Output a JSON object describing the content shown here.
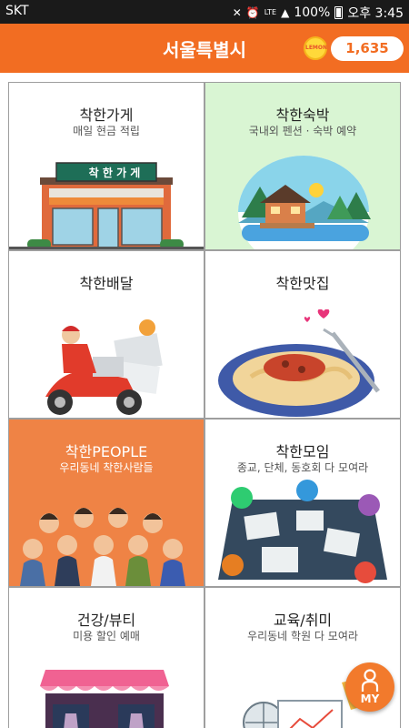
{
  "status_bar": {
    "carrier": "SKT",
    "battery": "100%",
    "time": "오후 3:45",
    "network": "LTE"
  },
  "app_bar": {
    "title": "서울특별시",
    "lemon_badge": "LEMON",
    "points": "1,635"
  },
  "tiles": [
    {
      "title": "착한가게",
      "subtitle": "매일 현금 적립",
      "sign": "착 한 가 게"
    },
    {
      "title": "착한숙박",
      "subtitle": "국내외 펜션 · 숙박 예약"
    },
    {
      "title": "착한배달",
      "subtitle": ""
    },
    {
      "title": "착한맛집",
      "subtitle": ""
    },
    {
      "title": "착한PEOPLE",
      "subtitle": "우리동네 착한사람들"
    },
    {
      "title": "착한모임",
      "subtitle": "종교, 단체, 동호회 다 모여라"
    },
    {
      "title": "건강/뷰티",
      "subtitle": "미용 할인 예매"
    },
    {
      "title": "교육/취미",
      "subtitle": "우리동네 학원 다 모여라"
    }
  ],
  "fab": {
    "label": "MY"
  },
  "colors": {
    "brand_orange": "#f26d22",
    "people_tile": "#ef8345",
    "lodging_tile": "#d9f5d3",
    "points_text": "#f26d22"
  }
}
